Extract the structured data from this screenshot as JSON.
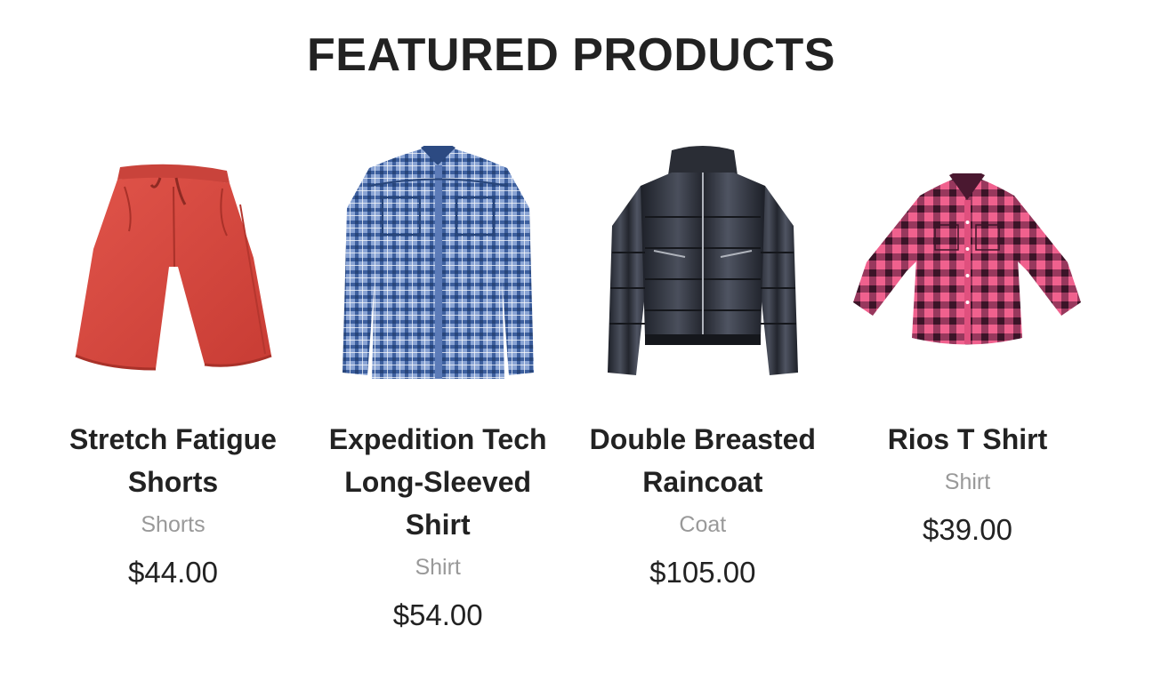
{
  "section": {
    "title": "FEATURED PRODUCTS"
  },
  "products": [
    {
      "name": "Stretch Fatigue Shorts",
      "category": "Shorts",
      "price": "$44.00",
      "image_icon": "red-shorts-image",
      "color": "#d9493f"
    },
    {
      "name": "Expedition Tech Long-Sleeved Shirt",
      "category": "Shirt",
      "price": "$54.00",
      "image_icon": "blue-plaid-shirt-image",
      "color": "#4a6ea8"
    },
    {
      "name": "Double Breasted Raincoat",
      "category": "Coat",
      "price": "$105.00",
      "image_icon": "black-puffer-jacket-image",
      "color": "#2a2e36"
    },
    {
      "name": "Rios T Shirt",
      "category": "Shirt",
      "price": "$39.00",
      "image_icon": "pink-plaid-shirt-image",
      "color": "#e84d7a"
    }
  ]
}
